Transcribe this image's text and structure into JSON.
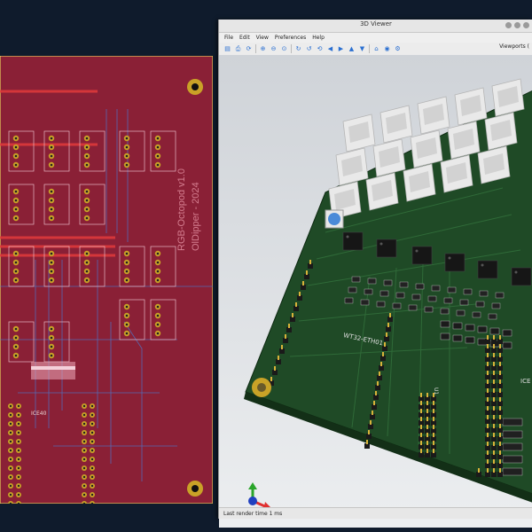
{
  "viewer": {
    "title": "3D Viewer",
    "menu": [
      "File",
      "Edit",
      "View",
      "Preferences",
      "Help"
    ],
    "viewports_label": "Viewports (",
    "status": "Last render time 1 ms"
  },
  "pcb2d": {
    "board_text": [
      "RGB-Octopod v1.0",
      "OlDipper - 2024"
    ],
    "label_ice": "ICE40"
  },
  "board3d": {
    "labels": {
      "module": "WT32-ETH01",
      "u1": "U1",
      "ice": "ICE"
    }
  },
  "colors": {
    "pcb_red": "#8a2036",
    "pcb_green": "#1f4a26",
    "pad_gold": "#c9a227",
    "accent_blue": "#2a6fd1"
  },
  "icons": [
    "file-icon",
    "print-icon",
    "refresh-icon",
    "zoom-in-icon",
    "zoom-out-icon",
    "zoom-fit-icon",
    "rotate-x-icon",
    "rotate-y-icon",
    "rotate-z-icon",
    "arrow-left-icon",
    "arrow-right-icon",
    "arrow-up-icon",
    "arrow-down-icon",
    "home-icon",
    "camera-icon",
    "settings-icon"
  ]
}
